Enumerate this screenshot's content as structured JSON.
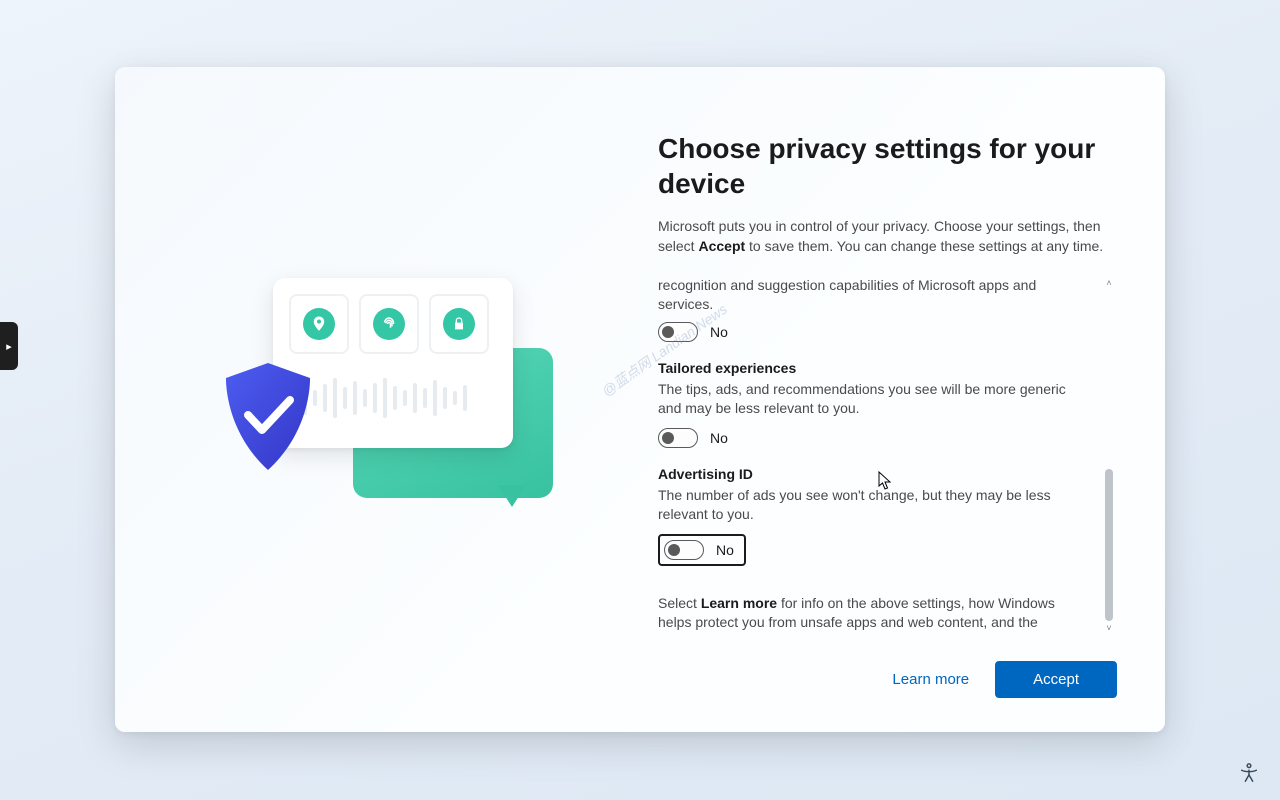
{
  "title": "Choose privacy settings for your device",
  "intro_pre": "Microsoft puts you in control of your privacy. Choose your settings, then select ",
  "intro_bold": "Accept",
  "intro_post": " to save them. You can change these settings at any time.",
  "partial_visible": "recognition and suggestion capabilities of Microsoft apps and services.",
  "toggle_off_label": "No",
  "settings": [
    {
      "title": "Tailored experiences",
      "desc": "The tips, ads, and recommendations you see will be more generic and may be less relevant to you.",
      "value": "No"
    },
    {
      "title": "Advertising ID",
      "desc": "The number of ads you see won't change, but they may be less relevant to you.",
      "value": "No",
      "focused": true
    }
  ],
  "footnote_pre": "Select ",
  "footnote_bold": "Learn more",
  "footnote_post": " for info on the above settings, how Windows helps protect you from unsafe apps and web content, and the related data transfers and uses.",
  "buttons": {
    "learn_more": "Learn more",
    "accept": "Accept"
  },
  "watermark": "@蓝点网 Landian.News",
  "icons": {
    "location": "location-pin-icon",
    "fingerprint": "fingerprint-icon",
    "lock": "lock-icon",
    "shield": "shield-check-icon",
    "scroll_up": "chevron-up-icon",
    "scroll_down": "chevron-down-icon",
    "accessibility": "accessibility-icon",
    "edge_tab": "expand-panel-icon"
  }
}
